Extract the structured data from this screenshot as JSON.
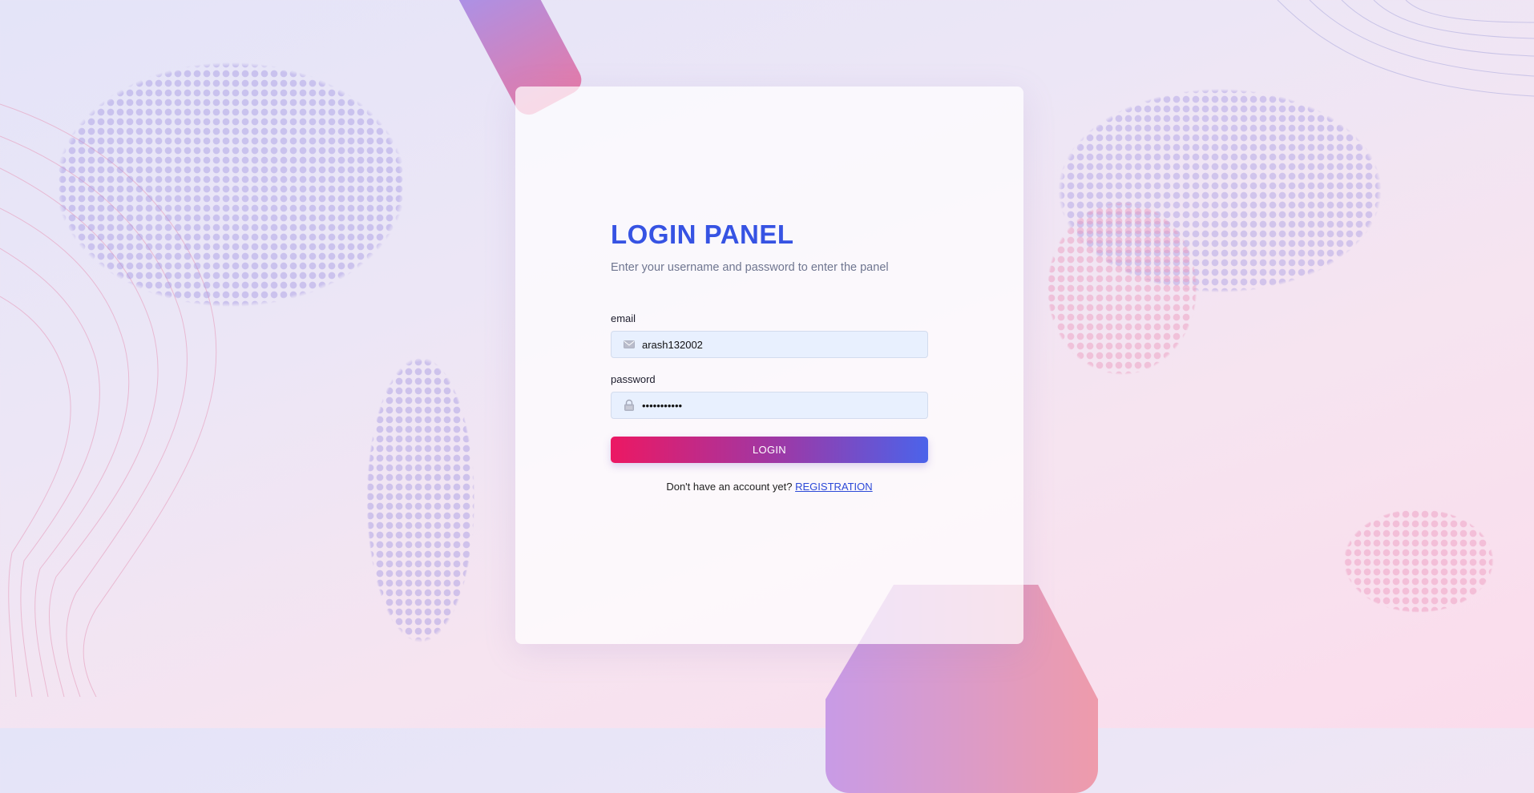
{
  "panel": {
    "title": "LOGIN PANEL",
    "subtitle": "Enter your username and password to enter the panel"
  },
  "email": {
    "label": "email",
    "value": "arash132002",
    "icon": "envelope-icon"
  },
  "password": {
    "label": "password",
    "value": "arash132002",
    "icon": "lock-icon"
  },
  "login_button": {
    "label": "LOGIN"
  },
  "footer": {
    "prompt": "Don't have an account yet?",
    "link_label": "REGISTRATION"
  },
  "colors": {
    "accent": "#3653e3",
    "button_start": "#ec1863",
    "button_end": "#4b63ea",
    "link": "#2c49d8"
  }
}
